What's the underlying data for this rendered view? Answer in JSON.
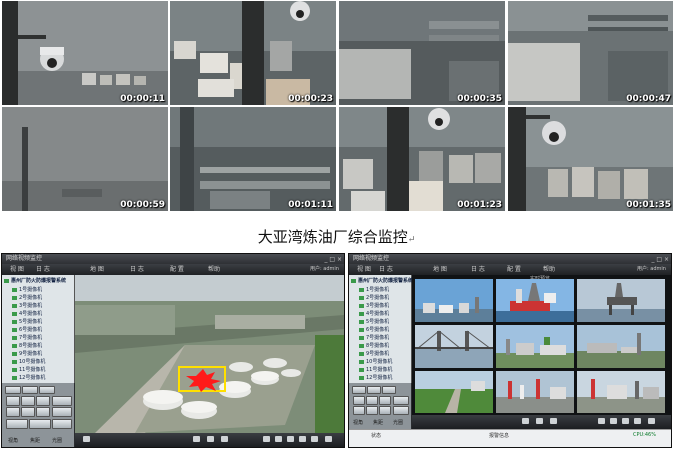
{
  "thumbnails": [
    {
      "time": "00:00:11"
    },
    {
      "time": "00:00:23"
    },
    {
      "time": "00:00:35"
    },
    {
      "time": "00:00:47"
    },
    {
      "time": "00:00:59"
    },
    {
      "time": "00:01:11"
    },
    {
      "time": "00:01:23"
    },
    {
      "time": "00:01:35"
    }
  ],
  "caption": "大亚湾炼油厂综合监控",
  "left_window": {
    "title": "网络视频监控",
    "menu": [
      "视 图",
      "日 志",
      "地 图",
      "日 志",
      "配 置",
      "帮助"
    ],
    "user": "用户: admin",
    "tree_root": "惠州厂防火防爆报警系统",
    "tree_items": [
      "1号摄像机",
      "2号摄像机",
      "3号摄像机",
      "4号摄像机",
      "5号摄像机",
      "6号摄像机",
      "7号摄像机",
      "8号摄像机",
      "9号摄像机",
      "10号摄像机",
      "11号摄像机",
      "12号摄像机"
    ],
    "ptz_labels": [
      "视角",
      "焦距",
      "光圈"
    ]
  },
  "right_window": {
    "title": "网络视频监控",
    "menu": [
      "视 图",
      "日 志",
      "地 图",
      "日 志",
      "配 置",
      "帮助"
    ],
    "user": "用户: admin",
    "view_label": "实时预览",
    "tree_root": "惠州厂防火防爆报警系统",
    "tree_items": [
      "1号摄像机",
      "2号摄像机",
      "3号摄像机",
      "4号摄像机",
      "5号摄像机",
      "6号摄像机",
      "7号摄像机",
      "8号摄像机",
      "9号摄像机",
      "10号摄像机",
      "11号摄像机",
      "12号摄像机"
    ],
    "ptz_labels": [
      "视角",
      "焦距",
      "光圈"
    ],
    "status_left": "状态",
    "status_mid": "报警信息",
    "status_right": "CPU:46%"
  },
  "colors": {
    "alarm": "#ff1a1a",
    "alarm_box": "#ffe000",
    "chrome": "#2a2c2f"
  }
}
